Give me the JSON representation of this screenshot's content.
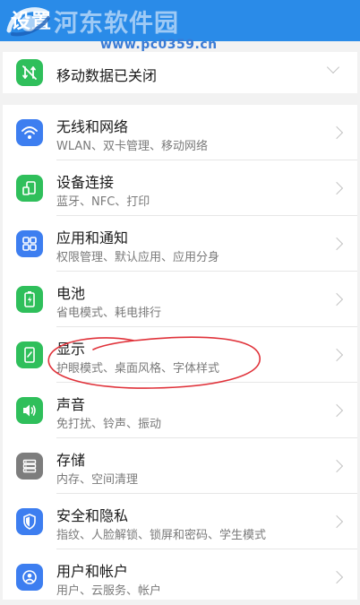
{
  "header": {
    "partial_title": "设置"
  },
  "watermark": {
    "site_name": "河东软件园",
    "url": "www.pc0359.cn"
  },
  "mobile_data": {
    "label": "移动数据已关闭",
    "icon": "mobile-data-off-icon"
  },
  "items": [
    {
      "title": "无线和网络",
      "subtitle": "WLAN、双卡管理、移动网络",
      "icon": "wifi-icon",
      "color": "#3d7ef0"
    },
    {
      "title": "设备连接",
      "subtitle": "蓝牙、NFC、打印",
      "icon": "device-connection-icon",
      "color": "#2fbf5b"
    },
    {
      "title": "应用和通知",
      "subtitle": "权限管理、默认应用、应用分身",
      "icon": "apps-icon",
      "color": "#3d7ef0"
    },
    {
      "title": "电池",
      "subtitle": "省电模式、耗电排行",
      "icon": "battery-icon",
      "color": "#2fbf5b"
    },
    {
      "title": "显示",
      "subtitle": "护眼模式、桌面风格、字体样式",
      "icon": "display-icon",
      "color": "#2fbf5b"
    },
    {
      "title": "声音",
      "subtitle": "免打扰、铃声、振动",
      "icon": "sound-icon",
      "color": "#2fbf5b"
    },
    {
      "title": "存储",
      "subtitle": "内存、空间清理",
      "icon": "storage-icon",
      "color": "#7d7d7d"
    },
    {
      "title": "安全和隐私",
      "subtitle": "指纹、人脸解锁、锁屏和密码、学生模式",
      "icon": "shield-icon",
      "color": "#3d7ef0"
    },
    {
      "title": "用户和帐户",
      "subtitle": "用户、云服务、帐户",
      "icon": "user-account-icon",
      "color": "#3d7ef0"
    }
  ],
  "annotation_color": "#e0323a"
}
